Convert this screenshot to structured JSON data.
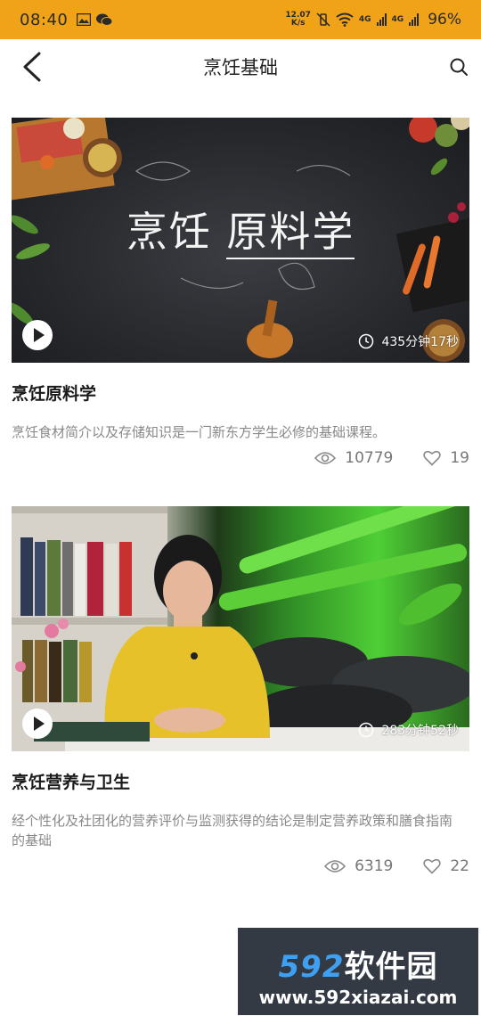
{
  "status_bar": {
    "time": "08:40",
    "net_speed_value": "12.07",
    "net_speed_unit": "K/s",
    "net_type_1": "4G",
    "net_type_2": "4G",
    "battery": "96%",
    "color": "#f0a318"
  },
  "nav": {
    "title": "烹饪基础",
    "back_icon": "chevron-left-icon",
    "search_icon": "search-icon"
  },
  "courses": [
    {
      "cover_text_1": "烹饪",
      "cover_text_2": "原料学",
      "duration": "435分钟17秒",
      "title": "烹饪原料学",
      "description": "烹饪食材简介以及存储知识是一门新东方学生必修的基础课程。",
      "views": "10779",
      "likes": "19"
    },
    {
      "duration": "283分钟52秒",
      "title": "烹饪营养与卫生",
      "description": "经个性化及社团化的营养评价与监测获得的结论是制定营养政策和膳食指南的基础",
      "views": "6319",
      "likes": "22"
    }
  ],
  "watermark": {
    "top_number": "592",
    "top_text": "软件园",
    "url": "www.592xiazai.com",
    "accent": "#3f9ff0"
  }
}
